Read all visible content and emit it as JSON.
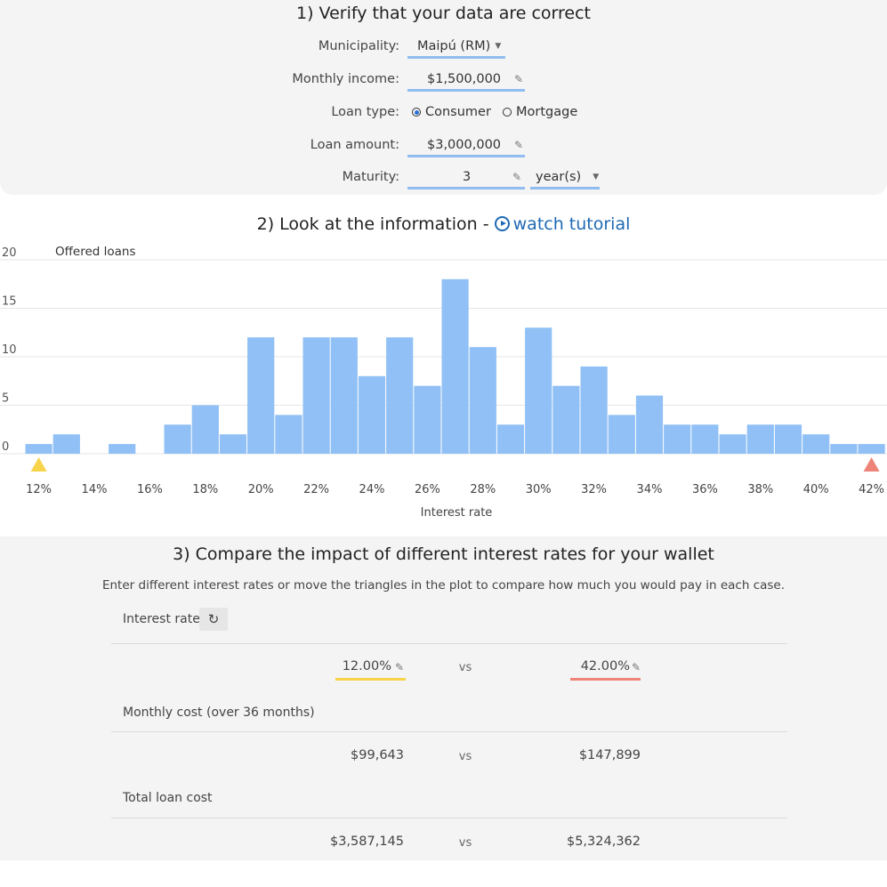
{
  "section1": {
    "title": "1) Verify that your data are correct",
    "municipality": {
      "label": "Municipality:",
      "value": "Maipú (RM)"
    },
    "income": {
      "label": "Monthly income:",
      "value": "$1,500,000"
    },
    "loan_type": {
      "label": "Loan type:",
      "options": [
        "Consumer",
        "Mortgage"
      ],
      "selected": "Consumer"
    },
    "loan_amount": {
      "label": "Loan amount:",
      "value": "$3,000,000"
    },
    "maturity": {
      "label": "Maturity:",
      "value": "3",
      "unit": "year(s)"
    }
  },
  "section2": {
    "title": "2) Look at the information - ",
    "tutorial_link": "watch tutorial"
  },
  "chart_data": {
    "type": "bar",
    "title": "Offered loans",
    "xlabel": "Interest rate",
    "ylabel": "",
    "ylim": [
      0,
      20
    ],
    "yticks": [
      "0",
      "5",
      "10",
      "15",
      "20"
    ],
    "xticks": [
      "12%",
      "14%",
      "16%",
      "18%",
      "20%",
      "22%",
      "24%",
      "26%",
      "28%",
      "30%",
      "32%",
      "34%",
      "36%",
      "38%",
      "40%",
      "42%"
    ],
    "bin_width_pct": 1,
    "x_start_pct": 11.5,
    "values": [
      1,
      2,
      0,
      1,
      0,
      3,
      5,
      2,
      12,
      4,
      12,
      12,
      8,
      12,
      7,
      18,
      11,
      3,
      13,
      7,
      9,
      4,
      6,
      3,
      3,
      2,
      3,
      3,
      2,
      1,
      1
    ],
    "grid": true,
    "bar_color": "#90c0f5",
    "markers": [
      {
        "rate_pct": 12,
        "color": "#f7d44a"
      },
      {
        "rate_pct": 42,
        "color": "#ee8478"
      }
    ]
  },
  "section3": {
    "title": "3) Compare the impact of different interest rates for your wallet",
    "subtitle": "Enter different interest rates or move the triangles in the plot to compare how much you would pay in each case.",
    "interest_label": "Interest rate",
    "rate_a": "12.00%",
    "rate_b": "42.00%",
    "vs": "vs",
    "monthly_label": "Monthly cost (over 36 months)",
    "monthly_a": "$99,643",
    "monthly_b": "$147,899",
    "total_label": "Total loan cost",
    "total_a": "$3,587,145",
    "total_b": "$5,324,362",
    "color_a": "#f7d44a",
    "color_b": "#ee8478"
  }
}
